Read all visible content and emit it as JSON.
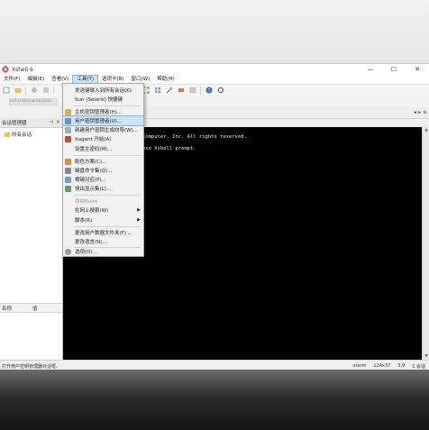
{
  "window": {
    "title": "Xshell 6",
    "controls": [
      "—",
      "☐",
      "✕"
    ]
  },
  "menubar": {
    "items": [
      {
        "label": "文件(F)"
      },
      {
        "label": "编辑(E)"
      },
      {
        "label": "查看(V)"
      },
      {
        "label": "工具(T)",
        "active": true
      },
      {
        "label": "选项卡(B)"
      },
      {
        "label": "窗口(W)"
      },
      {
        "label": "帮助(H)"
      }
    ]
  },
  "address": {
    "value": "ssh://username:pass",
    "placeholder": ""
  },
  "left_pane": {
    "header": "会话管理器",
    "tree_items": [
      "所有会话"
    ]
  },
  "properties": {
    "col_name": "名称",
    "col_value": "值"
  },
  "terminal": {
    "lines": [
      "Computer, Inc. All rights reserved.",
      "use Xshell prompt."
    ]
  },
  "tools_menu": {
    "items": [
      {
        "label": "发送键输入到所有会话(K)",
        "icon": "none"
      },
      {
        "label": "Sun (Solaris) 快捷键",
        "icon": "none"
      },
      {
        "sep": true
      },
      {
        "label": "主机密钥管理者(H)...",
        "icon": "key-icon"
      },
      {
        "label": "用户密钥管理者(U)...",
        "icon": "user-key-icon",
        "hover": true
      },
      {
        "label": "新建用户密钥生成向导(W)...",
        "icon": "wizard-icon"
      },
      {
        "label": "Xagent 开始(A)",
        "icon": "xagent-icon"
      },
      {
        "label": "设置主密码(M)...",
        "icon": "none"
      },
      {
        "sep": true
      },
      {
        "label": "配色方案(C)...",
        "icon": "color-scheme-icon"
      },
      {
        "label": "键盘命令集(Q)...",
        "icon": "keyboard-icon"
      },
      {
        "label": "横键对应(P)...",
        "icon": "mapping-icon"
      },
      {
        "label": "快出显示集(L)...",
        "icon": "display-icon"
      },
      {
        "sep": true
      },
      {
        "label": "强制Build",
        "icon": "none",
        "disabled": true
      },
      {
        "label": "在网上搜索(W)",
        "icon": "none",
        "submenu": true
      },
      {
        "label": "脚本(R)",
        "icon": "none",
        "submenu": true
      },
      {
        "sep": true
      },
      {
        "label": "更改用户数据文件夹(F)...",
        "icon": "none"
      },
      {
        "label": "更改语言(N)...",
        "icon": "none"
      },
      {
        "sep": true
      },
      {
        "label": "选项(O)...",
        "icon": "options-icon"
      }
    ]
  },
  "statusbar": {
    "left": "打开用户密钥管理器对话框。",
    "term": "xterm",
    "size": "124x37",
    "pos": "3,9",
    "sessions": "1 会话"
  },
  "colors": {
    "accent": "#cce4f7",
    "accent_border": "#7eb4ea",
    "terminal_bg": "#000000",
    "folder": "#e9c44a"
  }
}
